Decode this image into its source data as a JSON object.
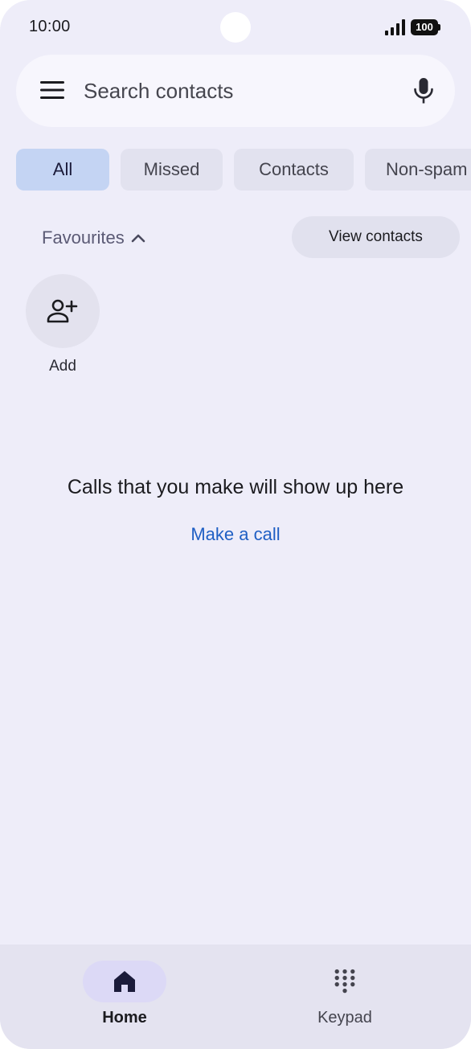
{
  "status_bar": {
    "time": "10:00",
    "battery": "100"
  },
  "search": {
    "placeholder": "Search contacts",
    "value": ""
  },
  "filters": [
    {
      "label": "All",
      "active": true
    },
    {
      "label": "Missed",
      "active": false
    },
    {
      "label": "Contacts",
      "active": false
    },
    {
      "label": "Non-spam",
      "active": false
    }
  ],
  "favourites": {
    "label": "Favourites",
    "view_contacts_label": "View contacts",
    "add_label": "Add"
  },
  "empty_state": {
    "message": "Calls that you make will show up here",
    "action_label": "Make a call"
  },
  "bottom_nav": {
    "home_label": "Home",
    "keypad_label": "Keypad"
  },
  "colors": {
    "background": "#eeedf9",
    "chip_active": "#c4d4f3",
    "link": "#1f5fc4"
  }
}
